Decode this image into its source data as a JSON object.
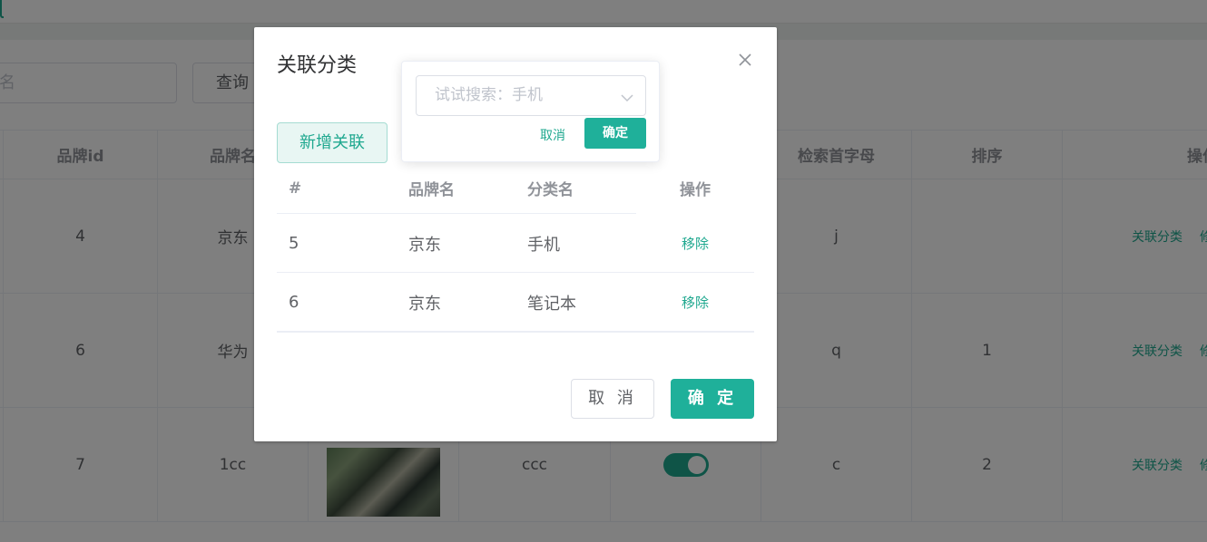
{
  "search": {
    "placeholder_fragment": "名",
    "query_label": "查询"
  },
  "background_table": {
    "headers": [
      "品牌id",
      "品牌名",
      "",
      "",
      "",
      "检索首字母",
      "排序",
      "操作"
    ],
    "rows": [
      {
        "id": "4",
        "name": "京东",
        "logo_visible": false,
        "descript": "",
        "show_status": "",
        "first_letter": "j",
        "sort": "",
        "actions": [
          "关联分类",
          "修"
        ]
      },
      {
        "id": "6",
        "name": "华为",
        "logo_visible": false,
        "descript": "",
        "show_status": "",
        "first_letter": "q",
        "sort": "1",
        "actions": [
          "关联分类",
          "修"
        ]
      },
      {
        "id": "7",
        "name": "1cc",
        "logo_visible": true,
        "descript": "ccc",
        "show_status": "on",
        "first_letter": "c",
        "sort": "2",
        "actions": [
          "关联分类",
          "修"
        ]
      }
    ]
  },
  "dialog": {
    "title": "关联分类",
    "close_icon": "close-icon",
    "add_button": "新增关联",
    "table": {
      "headers": [
        "#",
        "品牌名",
        "分类名",
        "操作"
      ],
      "rows": [
        {
          "id": "5",
          "brand": "京东",
          "category": "手机",
          "action": "移除"
        },
        {
          "id": "6",
          "brand": "京东",
          "category": "笔记本",
          "action": "移除"
        }
      ]
    },
    "cancel_label": "取 消",
    "confirm_label": "确 定"
  },
  "popover": {
    "select_placeholder": "试试搜索：手机",
    "chevron_icon": "chevron-down-icon",
    "cancel_label": "取消",
    "confirm_label": "确定"
  },
  "colors": {
    "accent": "#1fa88f",
    "mask": "rgba(0,0,0,0.5)"
  }
}
